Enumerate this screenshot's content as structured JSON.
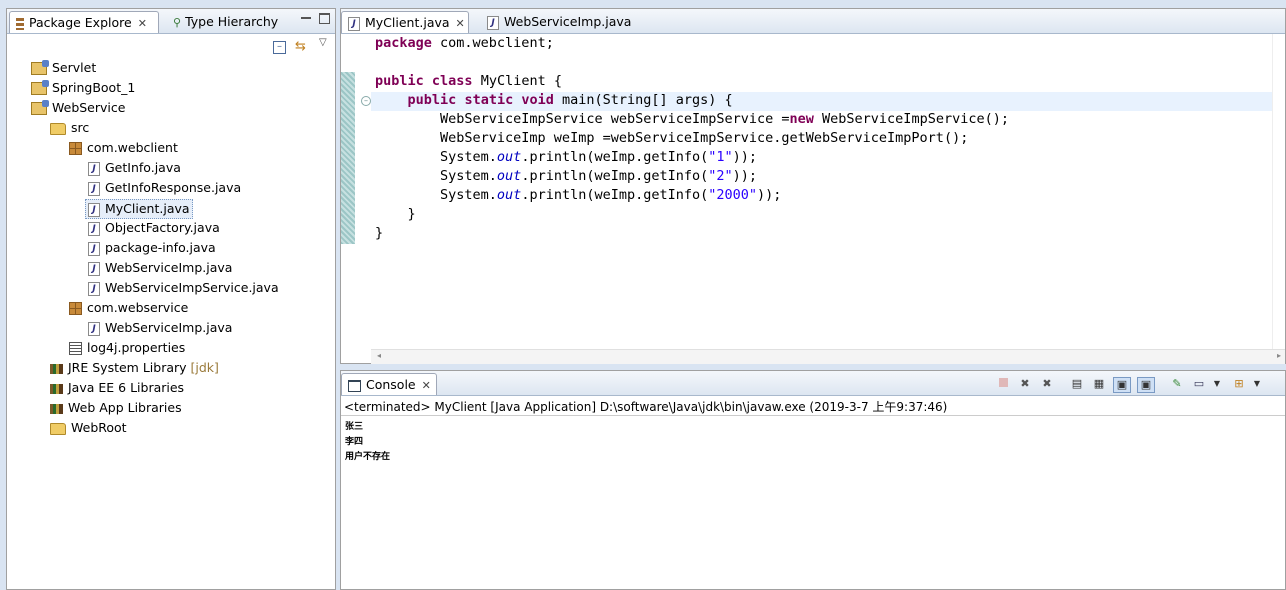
{
  "explorer": {
    "tabs": [
      {
        "label": "Package Explore",
        "active": true
      },
      {
        "label": "Type Hierarchy",
        "active": false
      }
    ],
    "tree": [
      {
        "label": "Servlet",
        "icon": "project-icon",
        "depth": 0
      },
      {
        "label": "SpringBoot_1",
        "icon": "maven-project-icon",
        "depth": 0
      },
      {
        "label": "WebService",
        "icon": "project-icon",
        "depth": 0
      },
      {
        "label": "src",
        "icon": "source-folder-icon",
        "depth": 1
      },
      {
        "label": "com.webclient",
        "icon": "package-icon",
        "depth": 2
      },
      {
        "label": "GetInfo.java",
        "icon": "java-file-icon",
        "depth": 3
      },
      {
        "label": "GetInfoResponse.java",
        "icon": "java-file-icon",
        "depth": 3
      },
      {
        "label": "MyClient.java",
        "icon": "java-file-icon",
        "depth": 3,
        "selected": true
      },
      {
        "label": "ObjectFactory.java",
        "icon": "java-file-icon",
        "depth": 3
      },
      {
        "label": "package-info.java",
        "icon": "java-file-icon",
        "depth": 3
      },
      {
        "label": "WebServiceImp.java",
        "icon": "java-file-icon",
        "depth": 3
      },
      {
        "label": "WebServiceImpService.java",
        "icon": "java-file-icon",
        "depth": 3
      },
      {
        "label": "com.webservice",
        "icon": "package-icon",
        "depth": 2
      },
      {
        "label": "WebServiceImp.java",
        "icon": "java-file-icon",
        "depth": 3
      },
      {
        "label": "log4j.properties",
        "icon": "properties-file-icon",
        "depth": 2
      },
      {
        "label": "JRE System Library",
        "suffix": "[jdk]",
        "icon": "library-icon",
        "depth": 1
      },
      {
        "label": "Java EE 6 Libraries",
        "icon": "library-icon",
        "depth": 1
      },
      {
        "label": "Web App Libraries",
        "icon": "library-icon",
        "depth": 1
      },
      {
        "label": "WebRoot",
        "icon": "folder-icon",
        "depth": 1
      }
    ]
  },
  "editor": {
    "tabs": [
      {
        "label": "MyClient.java",
        "active": true
      },
      {
        "label": "WebServiceImp.java",
        "active": false
      }
    ],
    "code_lines": [
      [
        {
          "t": "package",
          "c": "kw"
        },
        {
          "t": " com.webclient;"
        }
      ],
      [],
      [
        {
          "t": "public",
          "c": "kw"
        },
        {
          "t": " "
        },
        {
          "t": "class",
          "c": "kw"
        },
        {
          "t": " MyClient {"
        }
      ],
      [
        {
          "t": "    "
        },
        {
          "t": "public",
          "c": "kw"
        },
        {
          "t": " "
        },
        {
          "t": "static",
          "c": "kw"
        },
        {
          "t": " "
        },
        {
          "t": "void",
          "c": "kw"
        },
        {
          "t": " main(String[] args) {"
        }
      ],
      [
        {
          "t": "        WebServiceImpService webServiceImpService ="
        },
        {
          "t": "new",
          "c": "kw"
        },
        {
          "t": " WebServiceImpService();"
        }
      ],
      [
        {
          "t": "        WebServiceImp weImp =webServiceImpService.getWebServiceImpPort();"
        }
      ],
      [
        {
          "t": "        System."
        },
        {
          "t": "out",
          "c": "fld"
        },
        {
          "t": ".println(weImp.getInfo("
        },
        {
          "t": "\"1\"",
          "c": "str"
        },
        {
          "t": "));"
        }
      ],
      [
        {
          "t": "        System."
        },
        {
          "t": "out",
          "c": "fld"
        },
        {
          "t": ".println(weImp.getInfo("
        },
        {
          "t": "\"2\"",
          "c": "str"
        },
        {
          "t": "));"
        }
      ],
      [
        {
          "t": "        System."
        },
        {
          "t": "out",
          "c": "fld"
        },
        {
          "t": ".println(weImp.getInfo("
        },
        {
          "t": "\"2000\"",
          "c": "str"
        },
        {
          "t": "));"
        }
      ],
      [
        {
          "t": "    }"
        }
      ],
      [
        {
          "t": "}"
        }
      ]
    ]
  },
  "console": {
    "tab_label": "Console",
    "status": "<terminated> MyClient [Java Application] D:\\software\\Java\\jdk\\bin\\javaw.exe (2019-3-7 上午9:37:46)",
    "output": [
      "张三",
      "李四",
      "用户不存在"
    ]
  },
  "colors": {
    "keyword": "#7f0055",
    "string": "#2a00ff",
    "field": "#0000c0",
    "selection": "#e6eef9"
  }
}
